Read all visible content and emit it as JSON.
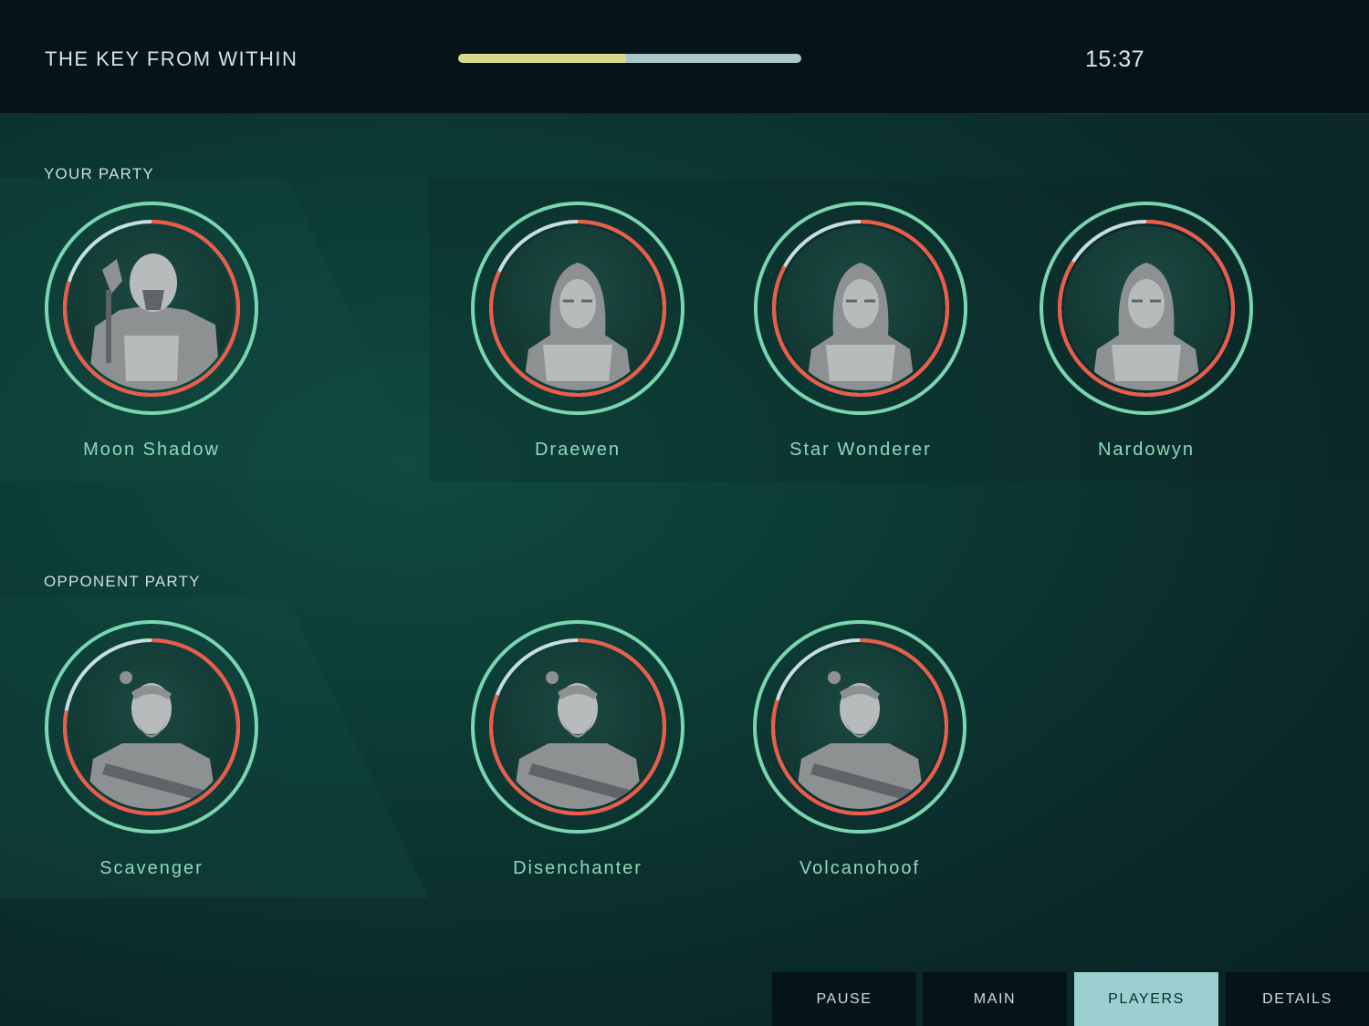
{
  "header": {
    "title": "THE KEY FROM WITHIN",
    "progress": 0.49,
    "timer": "15:37"
  },
  "colors": {
    "outer_ring": "#7ad6b0",
    "health_arc": "#f05a47",
    "ring_track": "#c8dede",
    "name_text": "#8fd9bb",
    "progress_fill": "#d9d98c",
    "progress_track": "#a9c6c9"
  },
  "your_party": {
    "label": "YOUR PARTY",
    "players": [
      {
        "name": "Moon Shadow",
        "figure": "armored-knight-icon",
        "health": 0.8
      },
      {
        "name": "Draewen",
        "figure": "hooded-woman-icon",
        "health": 0.82
      },
      {
        "name": "Star Wonderer",
        "figure": "hooded-woman-icon",
        "health": 0.83
      },
      {
        "name": "Nardowyn",
        "figure": "hooded-woman-icon",
        "health": 0.84
      }
    ]
  },
  "opponent_party": {
    "label": "OPPONENT PARTY",
    "players": [
      {
        "name": "Scavenger",
        "figure": "bearded-warrior-icon",
        "health": 0.78
      },
      {
        "name": "Disenchanter",
        "figure": "bearded-warrior-icon",
        "health": 0.81
      },
      {
        "name": "Volcanohoof",
        "figure": "bearded-warrior-icon",
        "health": 0.8
      }
    ]
  },
  "nav": {
    "pause": "PAUSE",
    "main": "MAIN",
    "players": "PLAYERS",
    "details": "DETAILS"
  }
}
